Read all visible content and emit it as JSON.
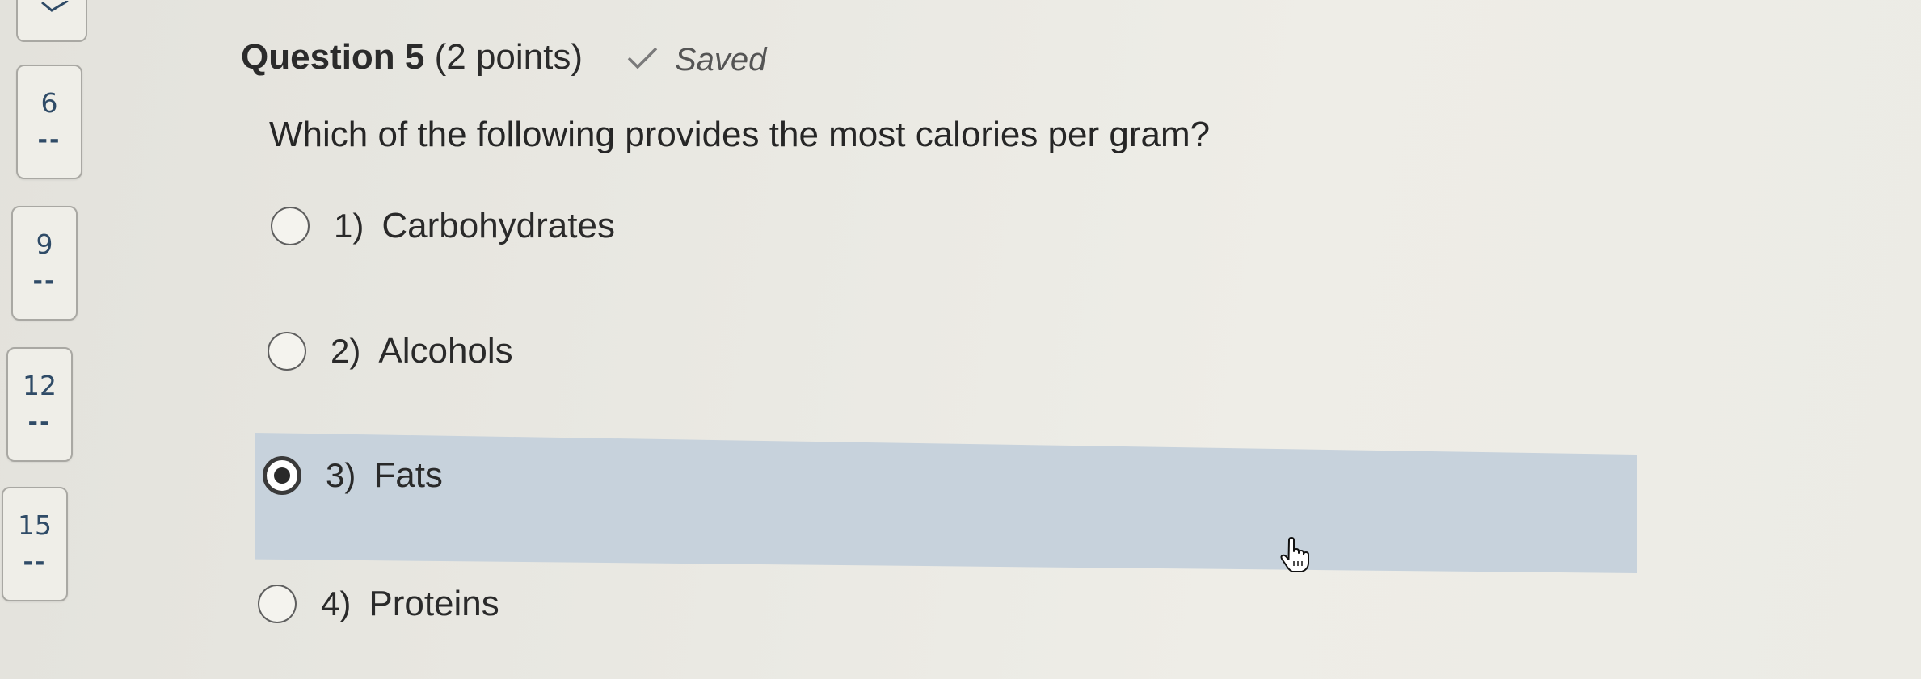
{
  "navigator": {
    "cards": [
      {
        "number": "6",
        "status": "--"
      },
      {
        "number": "9",
        "status": "--"
      },
      {
        "number": "12",
        "status": "--"
      },
      {
        "number": "15",
        "status": "--"
      }
    ]
  },
  "question": {
    "label": "Question 5",
    "points": "(2 points)",
    "status": "Saved",
    "text": "Which of the following provides the most calories per gram?",
    "selected_index": 2,
    "options": [
      {
        "number": "1)",
        "text": "Carbohydrates",
        "selected": false
      },
      {
        "number": "2)",
        "text": "Alcohols",
        "selected": false
      },
      {
        "number": "3)",
        "text": "Fats",
        "selected": true
      },
      {
        "number": "4)",
        "text": "Proteins",
        "selected": false
      }
    ]
  },
  "colors": {
    "highlight": "#c7d2dc",
    "nav_text": "#2f4b67"
  },
  "icons": {
    "saved": "checkmark-icon",
    "cursor": "hand-pointer-icon"
  }
}
